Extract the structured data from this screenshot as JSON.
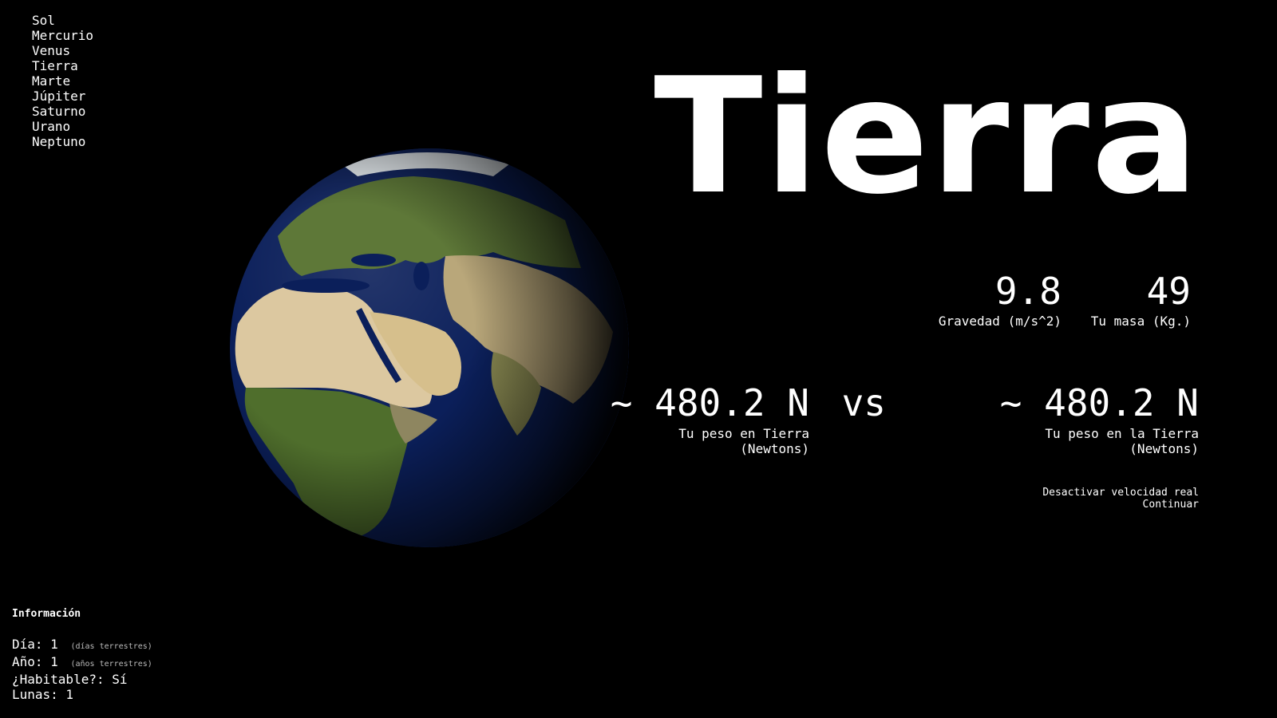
{
  "nav": {
    "items": [
      "Sol",
      "Mercurio",
      "Venus",
      "Tierra",
      "Marte",
      "Júpiter",
      "Saturno",
      "Urano",
      "Neptuno"
    ]
  },
  "planet": {
    "title": "Tierra",
    "gravity": {
      "value": "9.8",
      "label": "Gravedad (m/s^2)"
    },
    "mass": {
      "value": "49",
      "label": "Tu masa (Kg.)"
    },
    "weight_planet": {
      "value": "~ 480.2 N",
      "label": "Tu peso en Tierra\n(Newtons)"
    },
    "vs": "vs",
    "weight_earth": {
      "value": "~ 480.2 N",
      "label": "Tu peso en la Tierra\n(Newtons)"
    }
  },
  "actions": {
    "toggle_speed": "Desactivar velocidad real",
    "continue": "Continuar"
  },
  "info": {
    "title": "Información",
    "day_label": "Día:",
    "day_value": "1",
    "day_unit": "(días terrestres)",
    "year_label": "Año:",
    "year_value": "1",
    "year_unit": "(años terrestres)",
    "habitable": "¿Habitable?: Sí",
    "moons": "Lunas: 1"
  },
  "colors": {
    "background": "#000000",
    "text": "#ffffff",
    "ocean": "#0b1f5a",
    "land_green": "#5f7a35",
    "land_desert": "#d8c49a"
  }
}
